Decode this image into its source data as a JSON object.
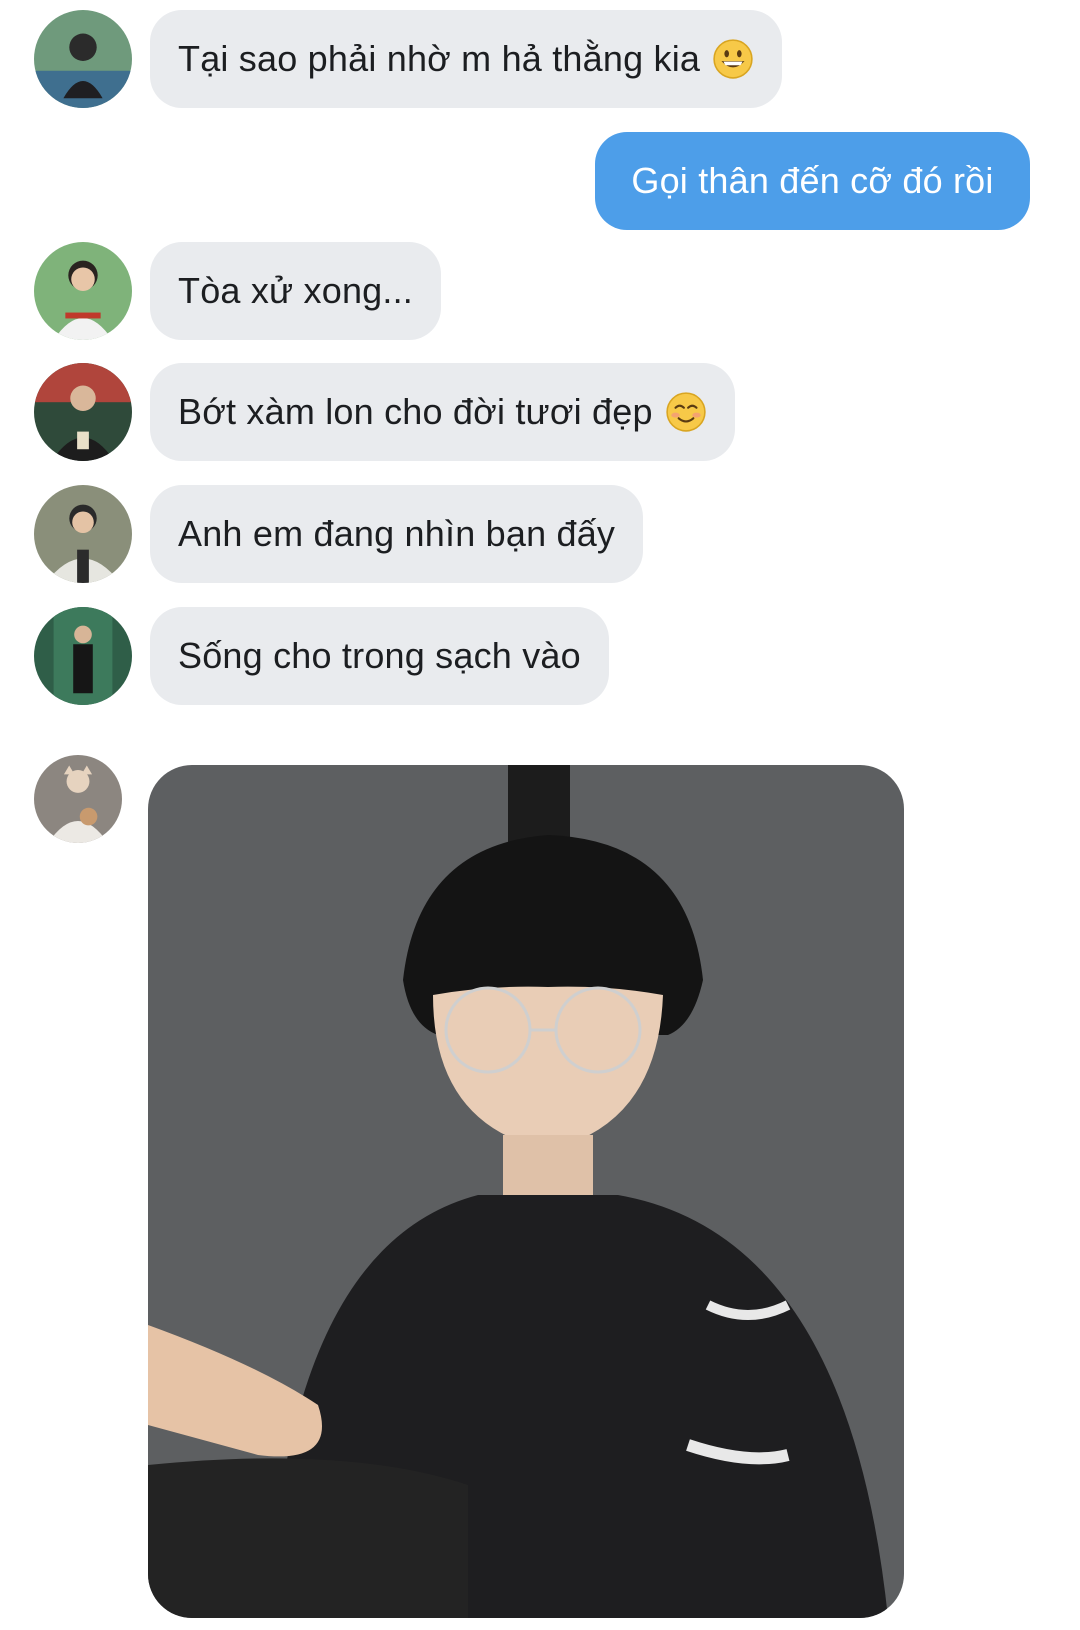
{
  "messages": [
    {
      "direction": "incoming",
      "text": "Tại sao phải nhờ m hả thằng kia",
      "emoji": "grinning-face-icon"
    },
    {
      "direction": "outgoing",
      "text": "Gọi thân đến cỡ đó rồi"
    },
    {
      "direction": "incoming",
      "text": "Tòa xử xong..."
    },
    {
      "direction": "incoming",
      "text": "Bớt xàm lon cho đời tươi đẹp",
      "emoji": "smiling-face-icon"
    },
    {
      "direction": "incoming",
      "text": "Anh em đang nhìn bạn đấy"
    },
    {
      "direction": "incoming",
      "text": "Sống cho trong sạch vào"
    },
    {
      "direction": "incoming",
      "attachment": "photo"
    }
  ],
  "colors": {
    "incoming_bubble": "#e9ebee",
    "outgoing_bubble": "#4d9ee9",
    "incoming_text": "#1c1e21",
    "outgoing_text": "#ffffff"
  }
}
